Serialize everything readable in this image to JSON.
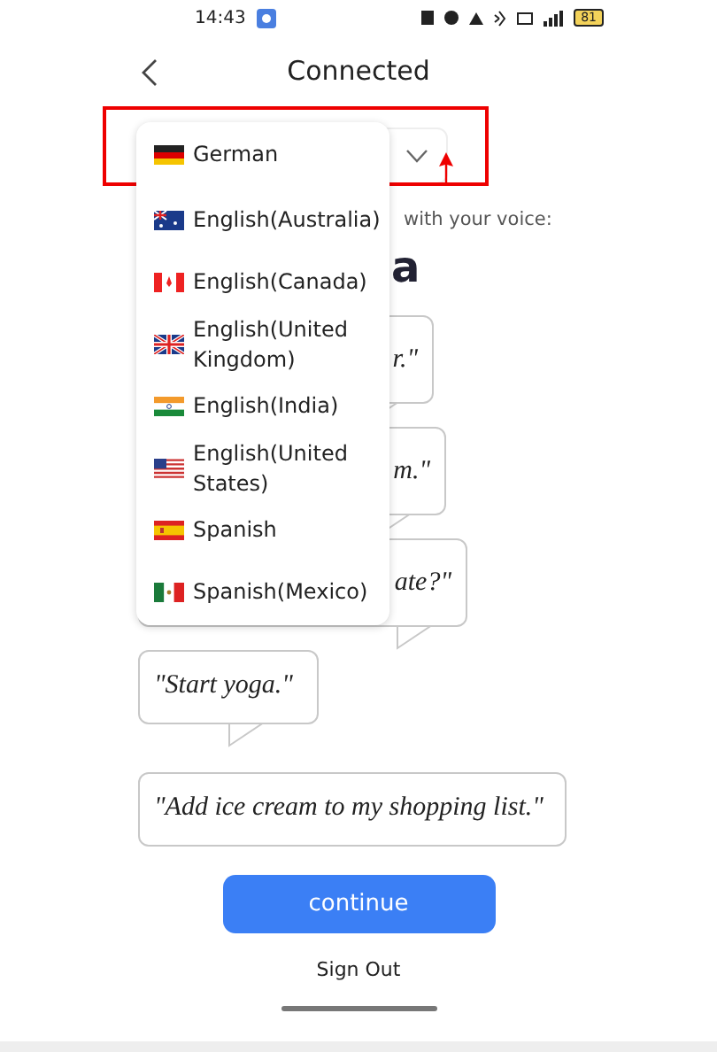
{
  "status_bar": {
    "time": "14:43",
    "battery": "81"
  },
  "header": {
    "title": "Connected"
  },
  "language_select": {
    "value": "German",
    "expanded": true
  },
  "language_menu": [
    {
      "label": "English(Australia)"
    },
    {
      "label": "English(Canada)"
    },
    {
      "label": "English(United Kingdom)"
    },
    {
      "label": "English(India)"
    },
    {
      "label": "English(United States)"
    },
    {
      "label": "Spanish"
    },
    {
      "label": "Spanish(Mexico)"
    }
  ],
  "subtitle": "with your voice:",
  "heading": "a",
  "examples": [
    {
      "text": "r.\"",
      "partial": true
    },
    {
      "text": "m.\"",
      "partial": true
    },
    {
      "text": "ate?\"",
      "partial": true
    },
    {
      "text": "\"Start yoga.\"",
      "partial": false
    },
    {
      "text": "\"Add ice cream to my shopping list.\"",
      "partial": false
    }
  ],
  "continue_button": "continue",
  "sign_out": "Sign Out"
}
